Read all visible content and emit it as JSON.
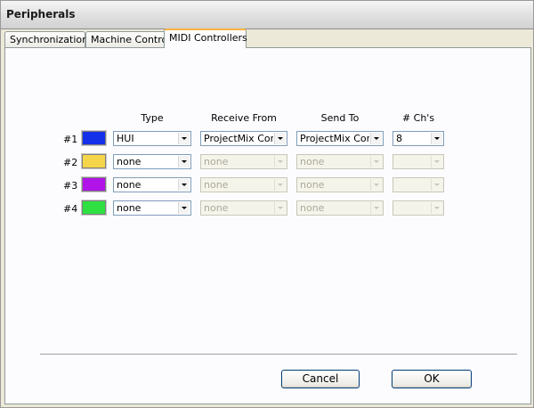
{
  "window": {
    "title": "Peripherals"
  },
  "tabs": [
    {
      "label": "Synchronization"
    },
    {
      "label": "Machine Control"
    },
    {
      "label": "MIDI Controllers"
    }
  ],
  "columns": {
    "type": "Type",
    "receive_from": "Receive From",
    "send_to": "Send To",
    "channels": "# Ch's"
  },
  "rows": [
    {
      "label": "#1",
      "color": "#1430e8",
      "type": "HUI",
      "receive_from": "ProjectMix Control",
      "send_to": "ProjectMix Control",
      "channels": "8",
      "enabled": true
    },
    {
      "label": "#2",
      "color": "#f5d64a",
      "type": "none",
      "receive_from": "none",
      "send_to": "none",
      "channels": "",
      "enabled": false
    },
    {
      "label": "#3",
      "color": "#b014e8",
      "type": "none",
      "receive_from": "none",
      "send_to": "none",
      "channels": "",
      "enabled": false
    },
    {
      "label": "#4",
      "color": "#2ee042",
      "type": "none",
      "receive_from": "none",
      "send_to": "none",
      "channels": "",
      "enabled": false
    }
  ],
  "buttons": {
    "cancel": "Cancel",
    "ok": "OK"
  }
}
